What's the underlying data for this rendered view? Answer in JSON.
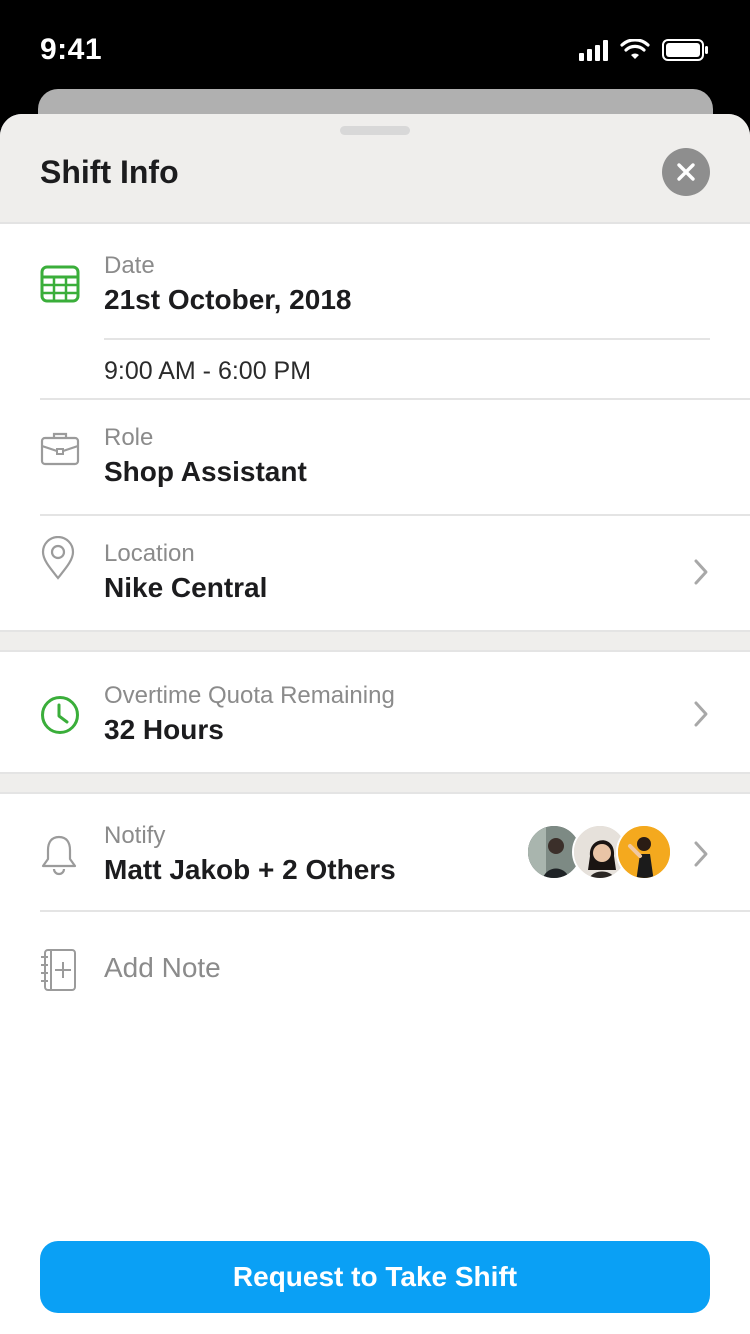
{
  "status_bar": {
    "time": "9:41"
  },
  "sheet": {
    "title": "Shift Info"
  },
  "date": {
    "label": "Date",
    "value": "21st October, 2018",
    "time_range": "9:00 AM - 6:00 PM"
  },
  "role": {
    "label": "Role",
    "value": "Shop Assistant"
  },
  "location": {
    "label": "Location",
    "value": "Nike Central"
  },
  "overtime": {
    "label": "Overtime Quota Remaining",
    "value": "32 Hours"
  },
  "notify": {
    "label": "Notify",
    "value": "Matt Jakob + 2 Others"
  },
  "note": {
    "placeholder": "Add Note"
  },
  "cta": {
    "label": "Request to Take Shift"
  },
  "colors": {
    "accent_green": "#3aae3a",
    "button_blue": "#0aa0f5",
    "icon_gray": "#9b9b9b"
  },
  "icons": [
    "calendar-icon",
    "briefcase-icon",
    "location-pin-icon",
    "clock-icon",
    "bell-icon",
    "notebook-plus-icon",
    "chevron-right-icon",
    "close-icon"
  ]
}
